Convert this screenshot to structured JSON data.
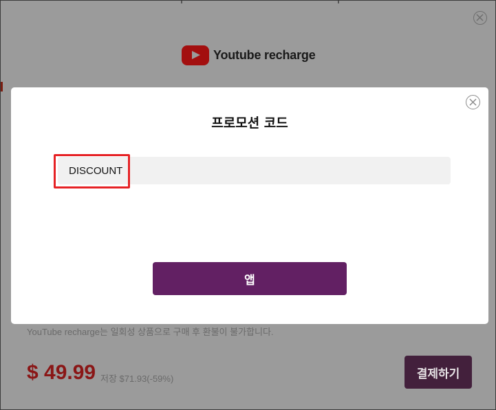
{
  "background_page": {
    "brand_name": "Youtube recharge",
    "notice": "YouTube recharge는 일회성 상품으로 구매 후 환불이 불가합니다.",
    "price": "$ 49.99",
    "savings": "저장 $71.93(-59%)",
    "pay_button_label": "결제하기"
  },
  "promo_modal": {
    "title": "프로모션 코드",
    "code_value": "DISCOUNT",
    "apply_button_label": "앱"
  },
  "colors": {
    "accent_purple": "#622063",
    "highlight_red": "#e62225",
    "price_red": "#8a1616"
  }
}
